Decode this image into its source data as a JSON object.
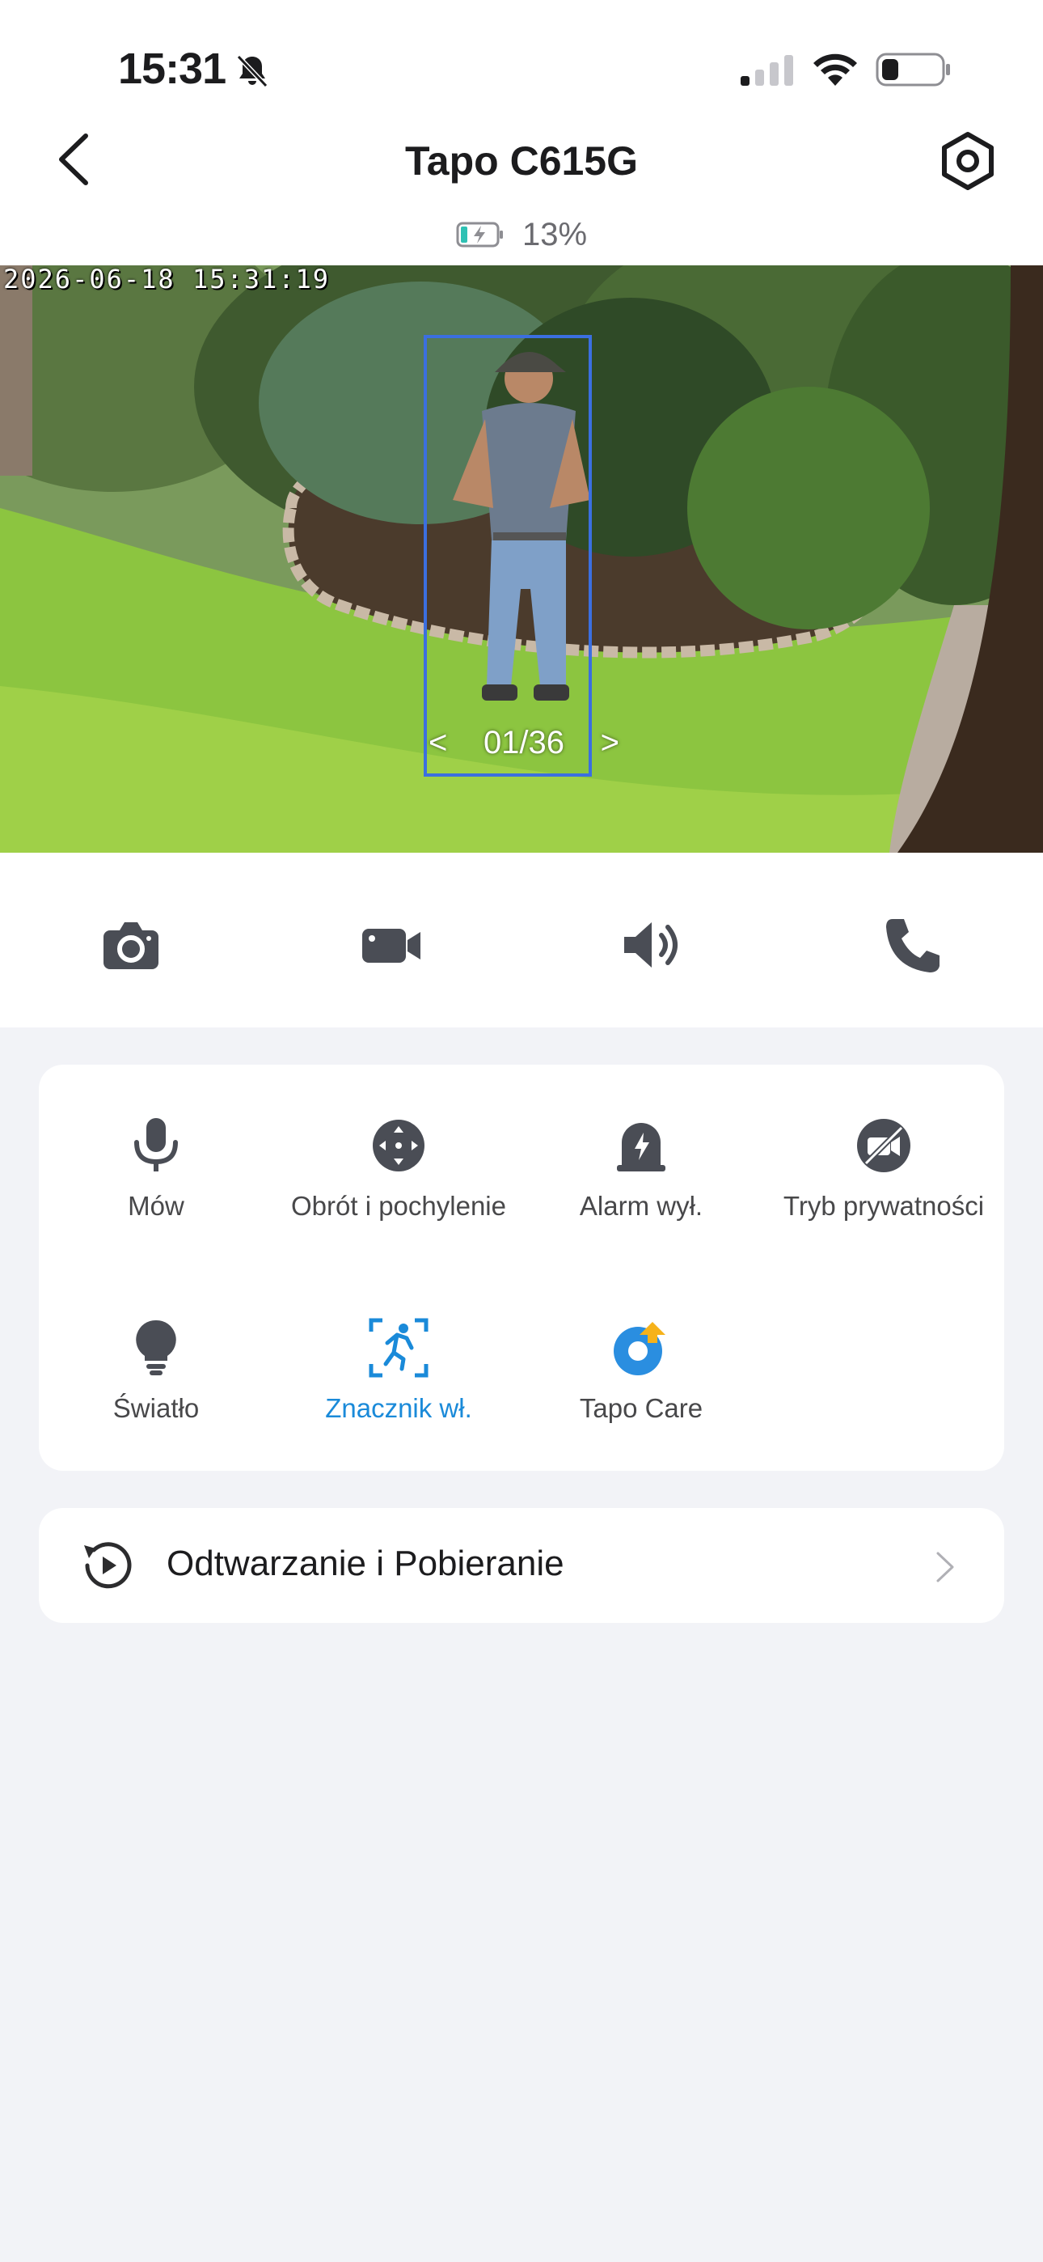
{
  "status_bar": {
    "time": "15:31"
  },
  "nav": {
    "title": "Tapo C615G"
  },
  "battery": {
    "percent": "13%"
  },
  "feed": {
    "timestamp": "2026-06-18 15:31:19",
    "counter": "01/36",
    "prev": "<",
    "next": ">"
  },
  "actions": [
    {
      "icon": "camera-icon"
    },
    {
      "icon": "video-camera-icon"
    },
    {
      "icon": "speaker-icon"
    },
    {
      "icon": "phone-icon"
    }
  ],
  "controls": [
    {
      "label": "Mów",
      "icon": "microphone-icon"
    },
    {
      "label": "Obrót i pochylenie",
      "icon": "pan-tilt-icon"
    },
    {
      "label": "Alarm wył.",
      "icon": "alarm-icon"
    },
    {
      "label": "Tryb prywatności",
      "icon": "privacy-mode-icon"
    },
    {
      "label": "Światło",
      "icon": "light-bulb-icon"
    },
    {
      "label": "Znacznik wł.",
      "icon": "motion-marker-icon",
      "active": true
    },
    {
      "label": "Tapo Care",
      "icon": "tapo-care-icon"
    }
  ],
  "playback": {
    "label": "Odtwarzanie i Pobieranie"
  },
  "colors": {
    "accent": "#1a8ad9",
    "detection_box": "#3b6fe0",
    "background": "#f2f3f7"
  }
}
